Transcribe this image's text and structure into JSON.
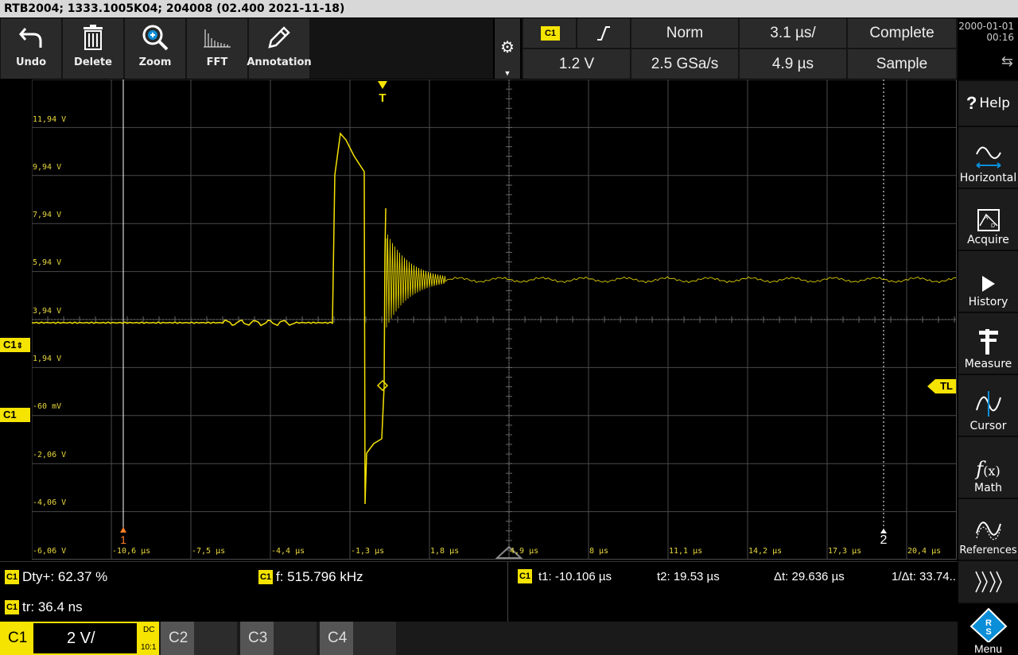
{
  "title_bar": "RTB2004; 1333.1005K04; 204008 (02.400 2021-11-18)",
  "toolbar": [
    {
      "label": "Undo",
      "icon": "undo-arrow-icon"
    },
    {
      "label": "Delete",
      "icon": "trash-icon"
    },
    {
      "label": "Zoom",
      "icon": "zoom-in-icon"
    },
    {
      "label": "FFT",
      "icon": "fft-spectrum-icon"
    },
    {
      "label": "Annotation",
      "icon": "pencil-icon"
    }
  ],
  "trigger": {
    "source": "C1",
    "slope_icon": "rising-edge-icon",
    "mode": "Norm",
    "timebase": "3.1 µs/",
    "status": "Complete",
    "level": "1.2 V",
    "sample_rate": "2.5 GSa/s",
    "position": "4.9 µs",
    "acq_mode": "Sample"
  },
  "clock": {
    "date": "2000-01-01",
    "time": "00:16"
  },
  "scope": {
    "y_labels": [
      "11,94 V",
      "9,94 V",
      "7,94 V",
      "5,94 V",
      "3,94 V",
      "1,94 V",
      "-60 mV",
      "-2,06 V",
      "-4,06 V",
      "-6,06 V"
    ],
    "x_labels": [
      "-10,6 µs",
      "-7,5 µs",
      "-4,4 µs",
      "-1,3 µs",
      "1,8 µs",
      "4,9 µs",
      "8 µs",
      "11,1 µs",
      "14,2 µs",
      "17,3 µs",
      "20,4 µs"
    ],
    "trigger_marker": "T",
    "trigger_level_marker": "TL",
    "cursor1_label": "1",
    "cursor2_label": "2",
    "channel_flag": "C1",
    "channel_flag_offset": "C1"
  },
  "sidebar": [
    {
      "label": "Help",
      "icon": "help-icon"
    },
    {
      "label": "Horizontal",
      "icon": "horizontal-icon"
    },
    {
      "label": "Acquire",
      "icon": "acquire-icon"
    },
    {
      "label": "History",
      "icon": "play-icon"
    },
    {
      "label": "Measure",
      "icon": "caliper-icon"
    },
    {
      "label": "Cursor",
      "icon": "cursor-icon"
    },
    {
      "label": "Math",
      "icon": "function-icon"
    },
    {
      "label": "References",
      "icon": "reference-icon"
    }
  ],
  "measurements": {
    "m1": {
      "badge": "C1",
      "text": "Dty+: 62.37 %"
    },
    "m2": {
      "badge": "C1",
      "text": "f: 515.796 kHz"
    },
    "m3": {
      "badge": "C1",
      "text": "tr: 36.4 ns"
    }
  },
  "cursor_readout": {
    "badge": "C1",
    "t1": "t1: -10.106 µs",
    "t2": "t2: 19.53 µs",
    "dt": "Δt: 29.636 µs",
    "inv_dt": "1/Δt: 33.74.."
  },
  "channel_bar": {
    "c1_name": "C1",
    "c1_scale": "2 V/",
    "c1_coupling": "DC",
    "c1_probe": "10:1",
    "c2_name": "C2",
    "c3_name": "C3",
    "c4_name": "C4"
  },
  "menu_label": "Menu",
  "colors": {
    "trace": "#f5e300",
    "grid": "#4a4a4a",
    "cursor": "#ffffff",
    "accent": "#0a8ed8"
  }
}
